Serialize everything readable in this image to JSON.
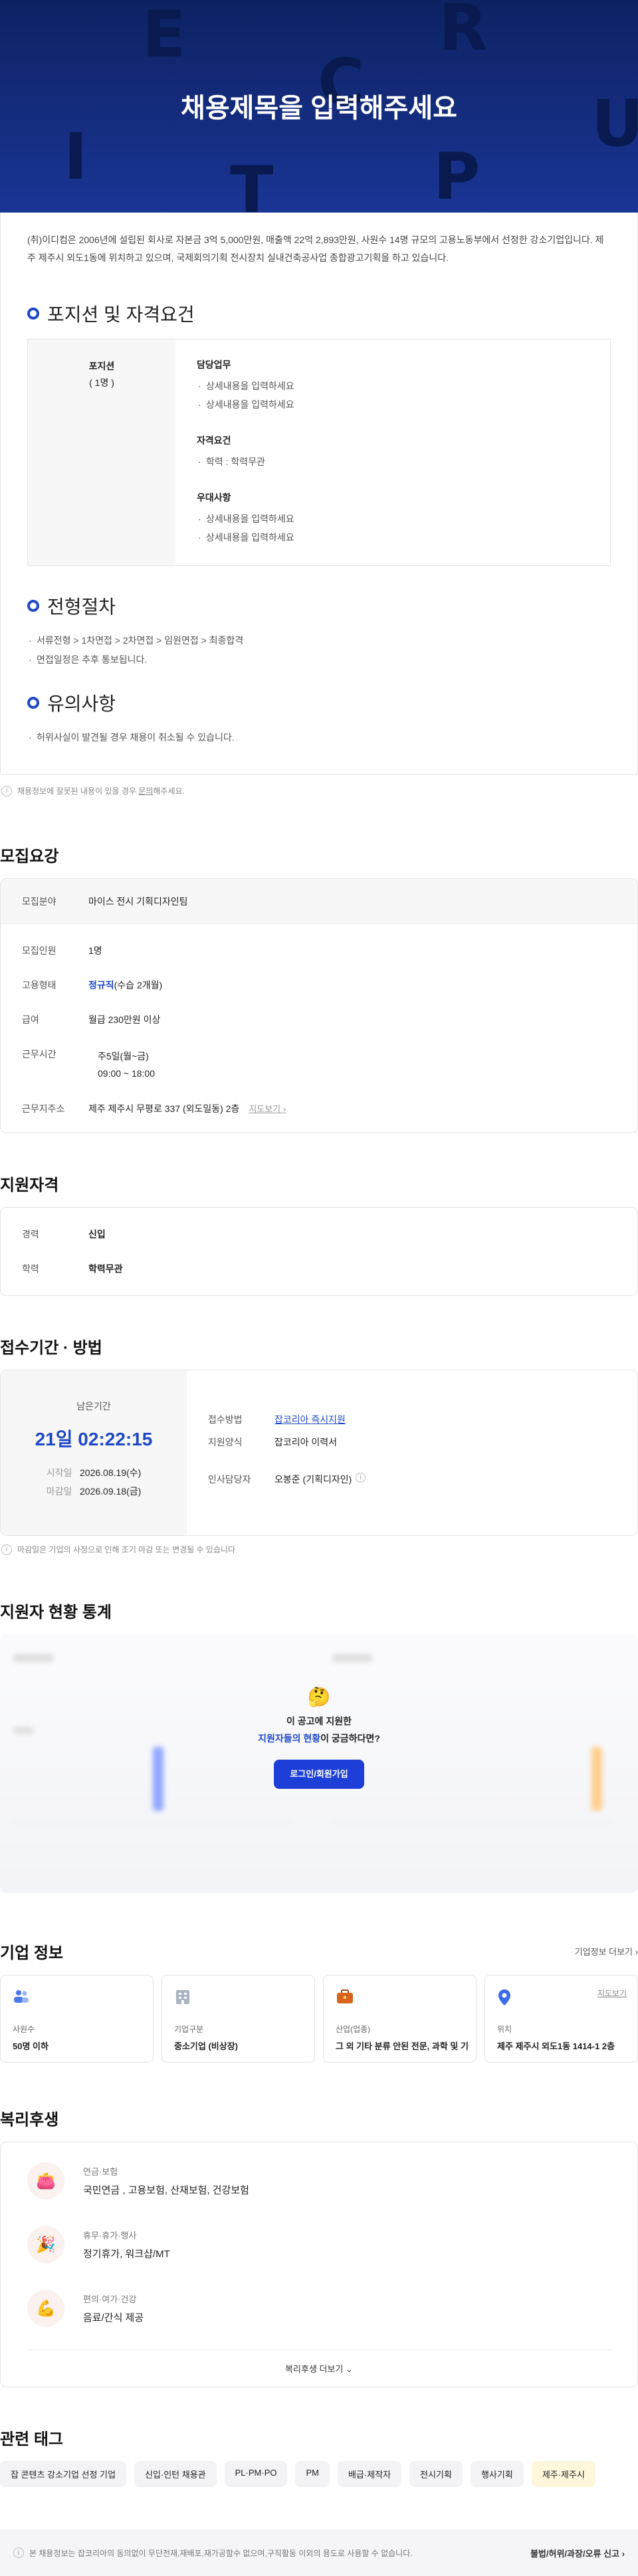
{
  "hero": {
    "title": "채용제목을 입력해주세요",
    "letters": [
      "E",
      "R",
      "C",
      "U",
      "I",
      "P",
      "T"
    ]
  },
  "intro": "(취)이디컴은 2006년에 설립된 회사로 자본금 3억 5,000만원, 매출액 22억 2,893만원, 사원수 14명 규모의 고용노동부에서 선정한 강소기업입니다. 제주 제주시 외도1동에 위치하고 있으며, 국제회의기획 전시장치 실내건축공사업 종합광고기획을 하고 있습니다.",
  "position": {
    "heading": "포지션 및 자격요건",
    "name": "포지션",
    "count": "( 1명 )",
    "groups": [
      {
        "title": "담당업무",
        "items": [
          "상세내용을 입력하세요",
          "상세내용을 입력하세요"
        ]
      },
      {
        "title": "자격요건",
        "items": [
          "학력 : 학력무관"
        ]
      },
      {
        "title": "우대사항",
        "items": [
          "상세내용을 입력하세요",
          "상세내용을 입력하세요"
        ]
      }
    ]
  },
  "process": {
    "heading": "전형절차",
    "items": [
      "서류전형 > 1차면접 > 2차면접 > 임원면접 > 최종합격",
      "면접일정은 추후 통보됩니다."
    ]
  },
  "caution": {
    "heading": "유의사항",
    "items": [
      "허위사실이 발견될 경우 채용이 취소될 수 있습니다."
    ]
  },
  "report_note": {
    "before": "채용정보에 잘못된 내용이 있을 경우 ",
    "link": "문의",
    "after": "해주세요."
  },
  "recruit": {
    "heading": "모집요강",
    "field_label": "모집분야",
    "field_value": "마이스 전시 기획디자인팀",
    "headcount_label": "모집인원",
    "headcount_value": "1명",
    "type_label": "고용형태",
    "type_value": "정규직",
    "type_suffix": "(수습 2개월)",
    "salary_label": "급여",
    "salary_value": "월급 230만원 이상",
    "hours_label": "근무시간",
    "hours_items": [
      "주5일(월~금)",
      "09:00 ~ 18:00"
    ],
    "addr_label": "근무지주소",
    "addr_value": "제주 제주시 무평로 337 (외도일동) 2층",
    "map_link": "지도보기"
  },
  "qualify": {
    "heading": "지원자격",
    "career_label": "경력",
    "career_value": "신입",
    "edu_label": "학력",
    "edu_value": "학력무관"
  },
  "apply": {
    "heading": "접수기간 · 방법",
    "remain_label": "남은기간",
    "remain_value": "21일 02:22:15",
    "start_label": "시작일",
    "start_value": "2026.08.19(수)",
    "end_label": "마감일",
    "end_value": "2026.09.18(금)",
    "method_label": "접수방법",
    "method_value": "잡코리아 즉시지원",
    "form_label": "지원양식",
    "form_value": "잡코리아 이력서",
    "manager_label": "인사담당자",
    "manager_value": "오봉준 (기획디자인)",
    "note": "마감일은 기업의 사정으로 인해 조기 마감 또는 변경될 수 있습니다"
  },
  "stats": {
    "heading": "지원자 현황 통계",
    "emoji": "🤔",
    "q1": "이 공고에 지원한",
    "q2_blue": "지원자들의 현황",
    "q2_rest": "이 궁금하다면?",
    "button": "로그인/회원가입"
  },
  "company": {
    "heading": "기업 정보",
    "more": "기업정보 더보기",
    "cards": [
      {
        "label": "사원수",
        "value": "50명 이하",
        "icon": "people-icon"
      },
      {
        "label": "기업구분",
        "value": "중소기업 (비상장)",
        "icon": "building-icon"
      },
      {
        "label": "산업(업종)",
        "value": "그 외 기타 분류 안된 전문, 과학 및 기술 서비스업",
        "icon": "briefcase-icon"
      },
      {
        "label": "위치",
        "value": "제주 제주시 외도1동 1414-1 2층",
        "icon": "pin-icon",
        "link": "지도보기"
      }
    ]
  },
  "welfare": {
    "heading": "복리후생",
    "items": [
      {
        "title": "연금·보험",
        "value": "국민연금 , 고용보험, 산재보험, 건강보험",
        "emoji": "👛"
      },
      {
        "title": "휴무·휴가·행사",
        "value": "정기휴가, 워크샵/MT",
        "emoji": "🎉"
      },
      {
        "title": "편의·여가·건강",
        "value": "음료/간식 제공",
        "emoji": "💪"
      }
    ],
    "more": "복리후생 더보기"
  },
  "tags": {
    "heading": "관련 태그",
    "items": [
      "잡 콘텐츠 강소기업 선정 기업",
      "신입·인턴 채용관",
      "PL·PM·PO",
      "PM",
      "배급·제작자",
      "전시기획",
      "행사기획",
      "제주·제주시"
    ]
  },
  "footer": {
    "text": "본 채용정보는 잡코리아의 동의없이 무단전재,재배포,재가공할수 없으며,구직활동 이외의 용도로 사용할 수 없습니다.",
    "report": "불법/허위/과장/오류 신고"
  },
  "colors": {
    "brand": "#1f48c6",
    "hero": "#0d2262"
  }
}
